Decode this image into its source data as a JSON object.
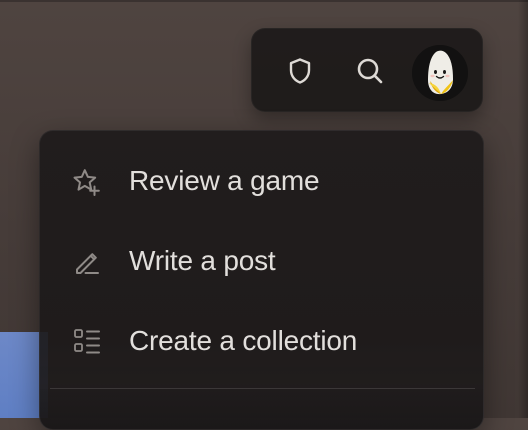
{
  "top_bar": {
    "icons": [
      {
        "name": "shield-icon"
      },
      {
        "name": "search-icon"
      }
    ],
    "avatar_icon": "banana-avatar"
  },
  "menu": {
    "items": [
      {
        "label": "Review a game",
        "icon": "star-plus-icon"
      },
      {
        "label": "Write a post",
        "icon": "pencil-icon"
      },
      {
        "label": "Create a collection",
        "icon": "list-grid-icon"
      }
    ]
  },
  "colors": {
    "menu_background": "#1d1a1a",
    "icon_color": "#8f8a87",
    "text_color": "#e2dfdc",
    "avatar_banana": "#efede7",
    "avatar_peel": "#f0c316"
  }
}
